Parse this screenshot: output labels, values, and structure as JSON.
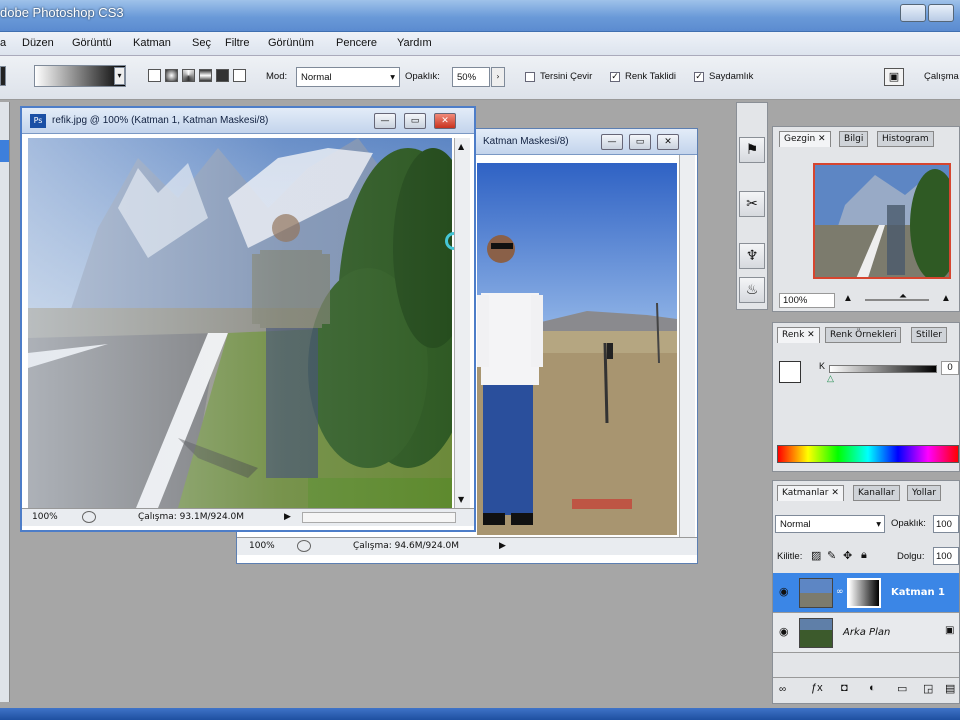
{
  "window": {
    "title": "dobe Photoshop CS3"
  },
  "menu": [
    "a",
    "Düzen",
    "Görüntü",
    "Katman",
    "Seç",
    "Filtre",
    "Görünüm",
    "Pencere",
    "Yardım"
  ],
  "options": {
    "mode_label": "Mod:",
    "mode_value": "Normal",
    "opacity_label": "Opaklık:",
    "opacity_value": "50%",
    "reverse_label": "Tersini Çevir",
    "dither_label": "Renk Taklidi",
    "transparency_label": "Saydamlık",
    "workspace_label": "Çalışma"
  },
  "doc_front": {
    "title": "refik.jpg @ 100% (Katman 1, Katman Maskesi/8)",
    "zoom": "100%",
    "status": "Çalışma: 93.1M/924.0M"
  },
  "doc_back": {
    "title": "Katman Maskesi/8)",
    "zoom": "100%",
    "status": "Çalışma: 94.6M/924.0M"
  },
  "navigator": {
    "tabs": [
      "Gezgin",
      "Bilgi",
      "Histogram"
    ],
    "zoom": "100%"
  },
  "color": {
    "tabs": [
      "Renk",
      "Renk Örnekleri",
      "Stiller"
    ],
    "channel": "K",
    "value": "0"
  },
  "layers": {
    "tabs": [
      "Katmanlar",
      "Kanallar",
      "Yollar"
    ],
    "blend_mode": "Normal",
    "opacity_label": "Opaklık:",
    "opacity_value": "100",
    "lock_label": "Kilitle:",
    "fill_label": "Dolgu:",
    "fill_value": "100",
    "items": [
      {
        "name": "Katman 1",
        "selected": true
      },
      {
        "name": "Arka Plan",
        "selected": false
      }
    ]
  },
  "colors": {
    "accent": "#3d7fdc",
    "title_bar": "#6a9ad8",
    "selected_layer": "#3b86e6"
  }
}
